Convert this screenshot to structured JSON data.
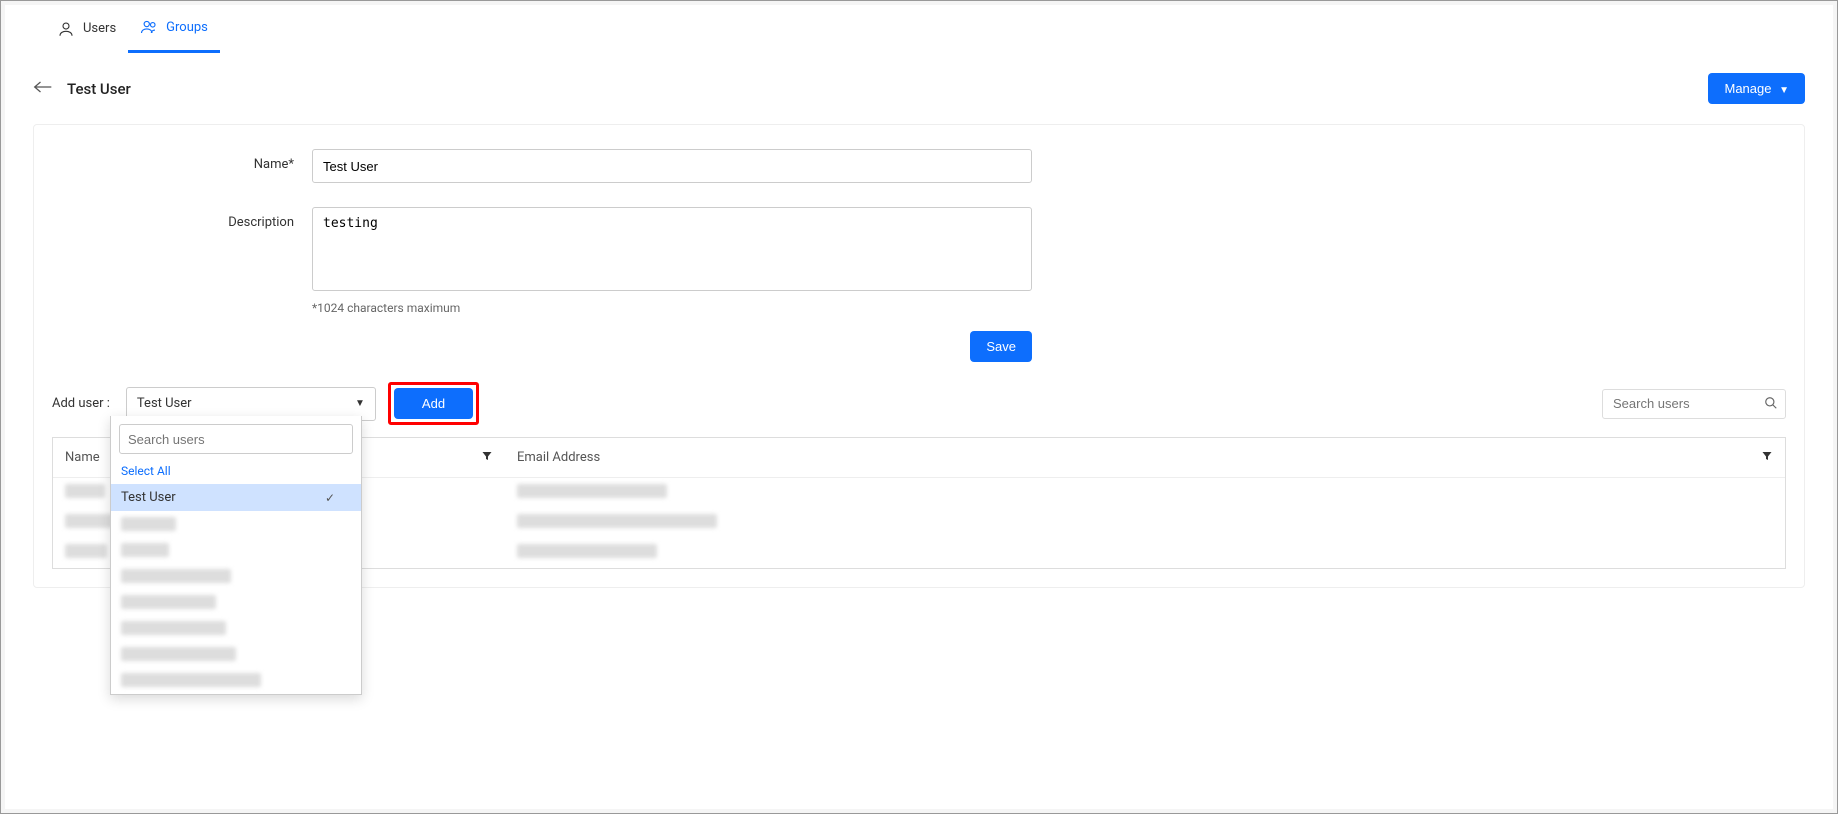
{
  "tabs": {
    "users": "Users",
    "groups": "Groups"
  },
  "header": {
    "title": "Test User",
    "manage": "Manage"
  },
  "form": {
    "name_label": "Name*",
    "name_value": "Test User",
    "desc_label": "Description",
    "desc_value": "testing",
    "desc_hint": "*1024 characters maximum",
    "save": "Save"
  },
  "adduser": {
    "label": "Add user :",
    "selected": "Test User",
    "add": "Add",
    "search_placeholder": "Search users",
    "dropdown_search_placeholder": "Search users",
    "select_all": "Select All",
    "options": {
      "first": "Test User"
    }
  },
  "table": {
    "col_name": "Name",
    "col_email": "Email Address"
  }
}
